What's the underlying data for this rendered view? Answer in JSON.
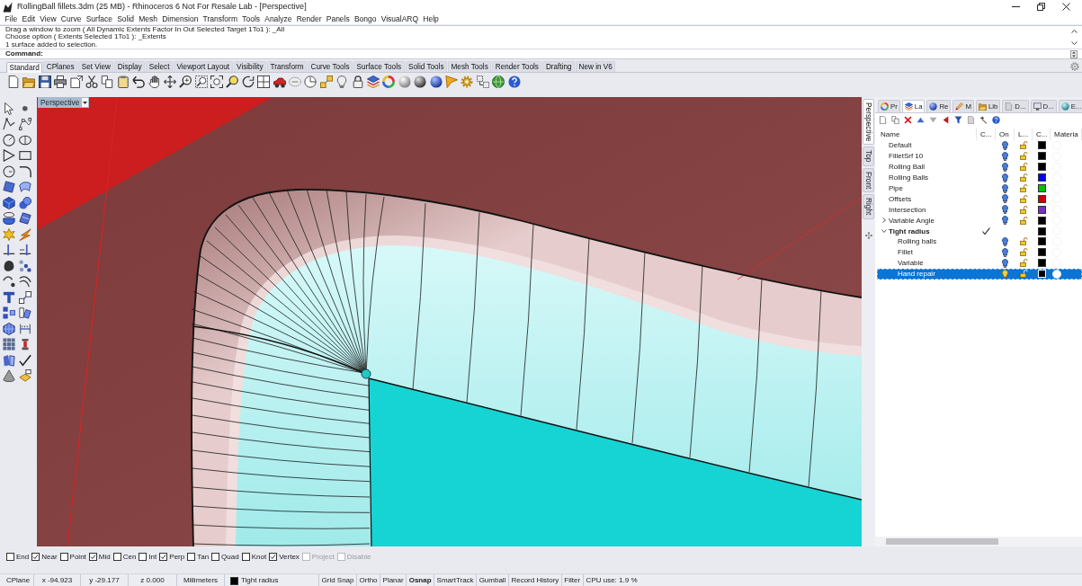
{
  "window": {
    "title": "RollingBall fillets.3dm (25 MB) - Rhinoceros 6 Not For Resale Lab - [Perspective]"
  },
  "menu": [
    "File",
    "Edit",
    "View",
    "Curve",
    "Surface",
    "Solid",
    "Mesh",
    "Dimension",
    "Transform",
    "Tools",
    "Analyze",
    "Render",
    "Panels",
    "Bongo",
    "VisualARQ",
    "Help"
  ],
  "command_history": [
    "Drag a window to zoom ( All Dynamic Extents Factor In Out Selected Target 1To1 ): _All",
    "Choose option ( Extents Selected 1To1 ): _Extents",
    "1 surface added to selection."
  ],
  "command_prompt": {
    "label": "Command:"
  },
  "toolbar_tabs": [
    {
      "label": "Standard",
      "selected": true
    },
    {
      "label": "CPlanes",
      "selected": false
    },
    {
      "label": "Set View",
      "selected": false
    },
    {
      "label": "Display",
      "selected": false
    },
    {
      "label": "Select",
      "selected": false
    },
    {
      "label": "Viewport Layout",
      "selected": false
    },
    {
      "label": "Visibility",
      "selected": false
    },
    {
      "label": "Transform",
      "selected": false
    },
    {
      "label": "Curve Tools",
      "selected": false
    },
    {
      "label": "Surface Tools",
      "selected": false
    },
    {
      "label": "Solid Tools",
      "selected": false
    },
    {
      "label": "Mesh Tools",
      "selected": false
    },
    {
      "label": "Render Tools",
      "selected": false
    },
    {
      "label": "Drafting",
      "selected": false
    },
    {
      "label": "New in V6",
      "selected": false
    }
  ],
  "viewport": {
    "title": "Perspective"
  },
  "viewport_tabs": [
    {
      "label": "Perspective",
      "selected": true
    },
    {
      "label": "Top",
      "selected": false
    },
    {
      "label": "Front",
      "selected": false
    },
    {
      "label": "Right",
      "selected": false
    }
  ],
  "panel_tabs": [
    {
      "label": "Pr",
      "selected": false
    },
    {
      "label": "La",
      "selected": true
    },
    {
      "label": "Re",
      "selected": false
    },
    {
      "label": "M",
      "selected": false
    },
    {
      "label": "Lib",
      "selected": false
    },
    {
      "label": "D...",
      "selected": false
    },
    {
      "label": "D...",
      "selected": false
    },
    {
      "label": "E...",
      "selected": false
    }
  ],
  "layers": {
    "columns": [
      "Name",
      "C...",
      "On",
      "L...",
      "C...",
      "Materia"
    ],
    "rows": [
      {
        "name": "Default",
        "current": false,
        "selected": false,
        "on": true,
        "locked": false,
        "color": "#000000"
      },
      {
        "name": "FilletSrf 10",
        "current": false,
        "selected": false,
        "on": true,
        "locked": false,
        "color": "#000000"
      },
      {
        "name": "Rolling Ball",
        "current": false,
        "selected": false,
        "on": true,
        "locked": false,
        "color": "#000000"
      },
      {
        "name": "Rolling Balls",
        "current": false,
        "selected": false,
        "on": true,
        "locked": false,
        "color": "#0000ff"
      },
      {
        "name": "Pipe",
        "current": false,
        "selected": false,
        "on": true,
        "locked": false,
        "color": "#00c000"
      },
      {
        "name": "Offsets",
        "current": false,
        "selected": false,
        "on": true,
        "locked": false,
        "color": "#cc0000"
      },
      {
        "name": "Intersection",
        "current": false,
        "selected": false,
        "on": true,
        "locked": false,
        "color": "#7a30c0"
      },
      {
        "name": "Variable Angle",
        "current": false,
        "selected": false,
        "expanded": false,
        "on": true,
        "locked": false,
        "color": "#000000"
      },
      {
        "name": "Tight radius",
        "current": true,
        "selected": false,
        "expanded": true,
        "color": "#000000",
        "children": [
          {
            "name": "Rolling balls",
            "current": false,
            "selected": false,
            "on": true,
            "locked": false,
            "color": "#000000"
          },
          {
            "name": "Fillet",
            "current": false,
            "selected": false,
            "on": true,
            "locked": false,
            "color": "#000000"
          },
          {
            "name": "Variable",
            "current": false,
            "selected": false,
            "on": true,
            "locked": false,
            "color": "#000000"
          },
          {
            "name": "Hand repair",
            "current": false,
            "selected": true,
            "on": true,
            "locked": false,
            "color": "#000000"
          }
        ]
      }
    ]
  },
  "osnaps": [
    {
      "label": "End",
      "checked": false,
      "disabled": false
    },
    {
      "label": "Near",
      "checked": true,
      "disabled": false
    },
    {
      "label": "Point",
      "checked": false,
      "disabled": false
    },
    {
      "label": "Mid",
      "checked": true,
      "disabled": false
    },
    {
      "label": "Cen",
      "checked": false,
      "disabled": false
    },
    {
      "label": "Int",
      "checked": false,
      "disabled": false
    },
    {
      "label": "Perp",
      "checked": true,
      "disabled": false
    },
    {
      "label": "Tan",
      "checked": false,
      "disabled": false
    },
    {
      "label": "Quad",
      "checked": false,
      "disabled": false
    },
    {
      "label": "Knot",
      "checked": false,
      "disabled": false
    },
    {
      "label": "Vertex",
      "checked": true,
      "disabled": false
    },
    {
      "label": "Project",
      "checked": false,
      "disabled": true
    },
    {
      "label": "Disable",
      "checked": false,
      "disabled": true
    }
  ],
  "status_bar": {
    "cplane": "CPlane",
    "coordinates": [
      "x -94.923",
      "y -29.177",
      "z 0.000"
    ],
    "units": "Millimeters",
    "layer": {
      "name": "Tight radius",
      "color": "#000000"
    },
    "toggles": [
      {
        "label": "Grid Snap",
        "on": false
      },
      {
        "label": "Ortho",
        "on": false
      },
      {
        "label": "Planar",
        "on": false
      },
      {
        "label": "Osnap",
        "on": true
      },
      {
        "label": "SmartTrack",
        "on": false
      },
      {
        "label": "Gumball",
        "on": false
      },
      {
        "label": "Record History",
        "on": false
      },
      {
        "label": "Filter",
        "on": false
      }
    ],
    "cpu": "CPU use: 1.9 %"
  }
}
